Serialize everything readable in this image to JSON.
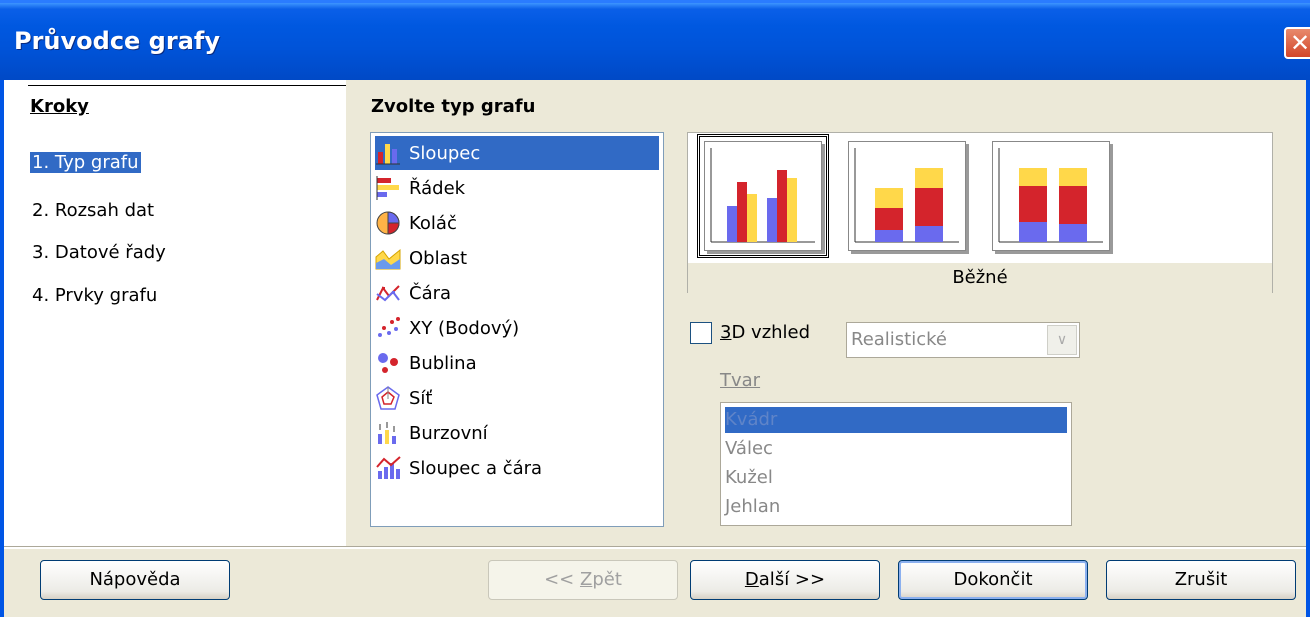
{
  "window": {
    "title": "Průvodce grafy",
    "close_glyph": "✕"
  },
  "steps": {
    "title": "Kroky",
    "items": [
      "1. Typ grafu",
      "2. Rozsah dat",
      "3. Datové řady",
      "4. Prvky grafu"
    ]
  },
  "chart_type": {
    "title": "Zvolte typ grafu",
    "items": [
      "Sloupec",
      "Řádek",
      "Koláč",
      "Oblast",
      "Čára",
      "XY (Bodový)",
      "Bublina",
      "Síť",
      "Burzovní",
      "Sloupec a čára"
    ],
    "selected": "Sloupec"
  },
  "variants": {
    "label": "Běžné",
    "colors": {
      "blue": "#6a6aee",
      "red": "#d4242c",
      "yellow": "#ffd84a"
    }
  },
  "options": {
    "three_d_label": "3D vzhled",
    "three_d_key": "3",
    "three_d_rest": "D vzhled",
    "three_d_checked": false,
    "look_value": "Realistické",
    "shape_label": "Tvar",
    "shape_items": [
      "Kvádr",
      "Válec",
      "Kužel",
      "Jehlan"
    ],
    "shape_selected": "Kvádr"
  },
  "buttons": {
    "help": "Nápověda",
    "back_prefix": "<< ",
    "back_key": "Z",
    "back_rest": "pět",
    "next_key": "D",
    "next_rest": "alší >>",
    "finish": "Dokončit",
    "cancel": "Zrušit"
  }
}
